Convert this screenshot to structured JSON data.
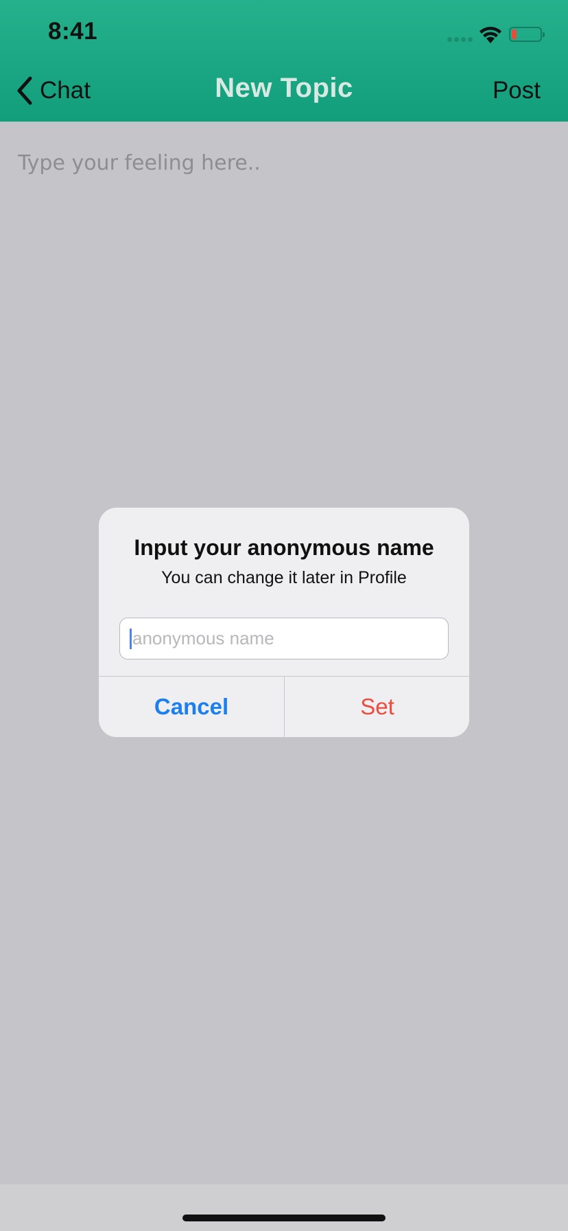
{
  "status_bar": {
    "time": "8:41",
    "battery_color": "#e94b3c"
  },
  "nav": {
    "back_label": "Chat",
    "title": "New Topic",
    "post_label": "Post"
  },
  "composer": {
    "placeholder": "Type your feeling here.."
  },
  "alert": {
    "title": "Input your anonymous name",
    "message": "You can change it later in Profile",
    "field_placeholder": "anonymous name",
    "cancel_label": "Cancel",
    "set_label": "Set"
  },
  "colors": {
    "header_top": "#24b18c",
    "header_bottom": "#139e7b",
    "cancel": "#1b7ff0",
    "set": "#ee4b3d",
    "dim_background": "#c5c4c9"
  },
  "icons": {
    "back": "chevron-left-icon",
    "wifi": "wifi-icon",
    "battery": "battery-icon"
  }
}
